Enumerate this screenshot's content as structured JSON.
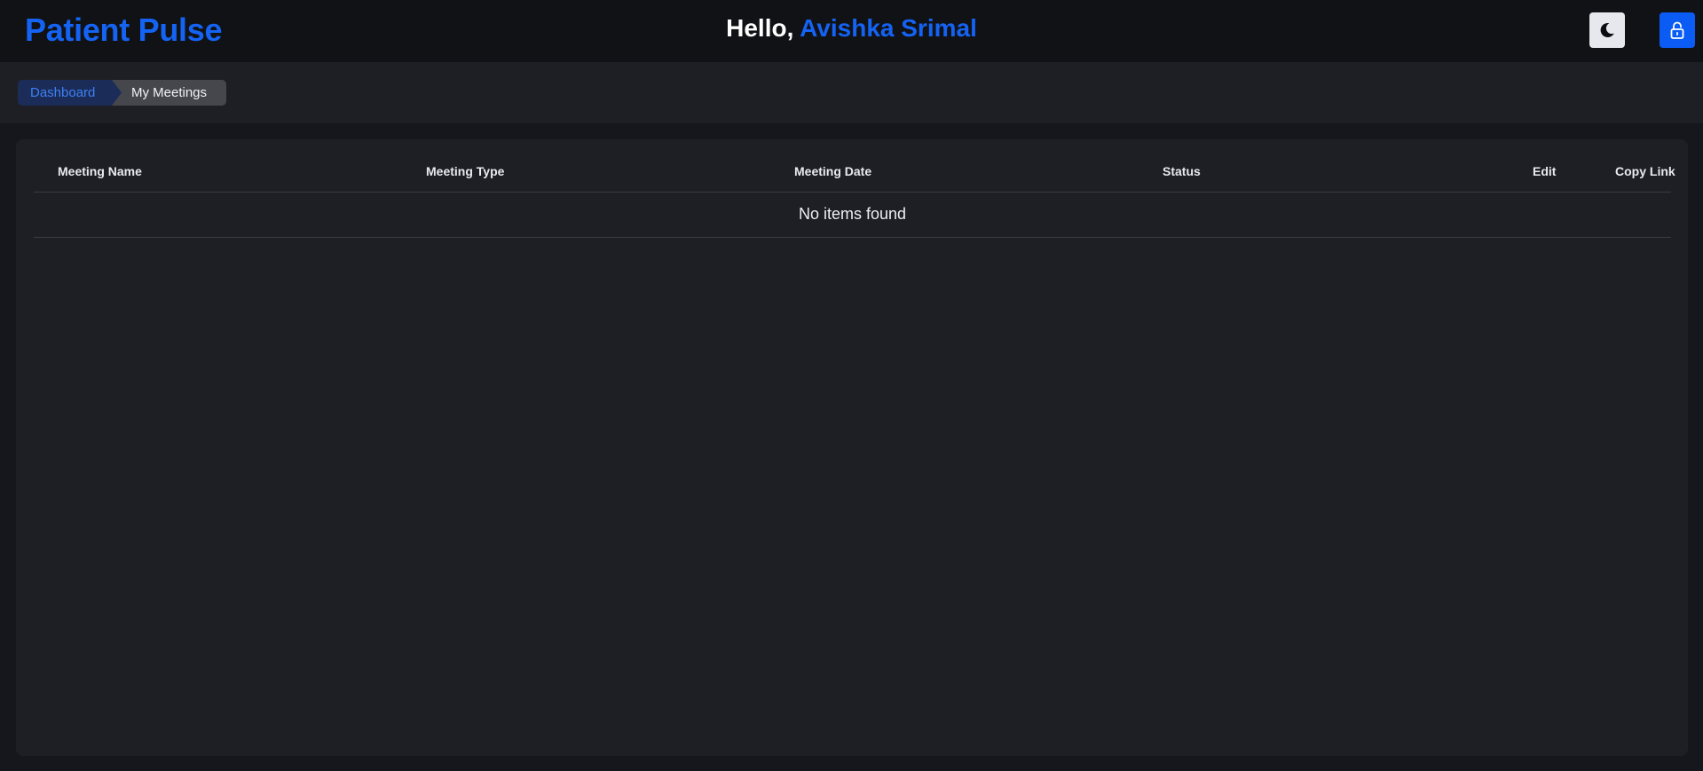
{
  "header": {
    "brand": "Patient Pulse",
    "greeting_prefix": "Hello, ",
    "user_name": "Avishka Srimal",
    "theme_toggle_icon": "moon-icon",
    "lock_icon": "lock-icon"
  },
  "breadcrumb": {
    "items": [
      {
        "label": "Dashboard"
      },
      {
        "label": "My Meetings"
      }
    ]
  },
  "table": {
    "columns": [
      "Meeting Name",
      "Meeting Type",
      "Meeting Date",
      "Status",
      "Edit",
      "Copy Link"
    ],
    "empty_message": "No items found",
    "rows": []
  },
  "colors": {
    "accent": "#1463f3",
    "header_bg": "#111216",
    "panel_bg": "#1e1f25",
    "page_bg": "#16171c"
  }
}
